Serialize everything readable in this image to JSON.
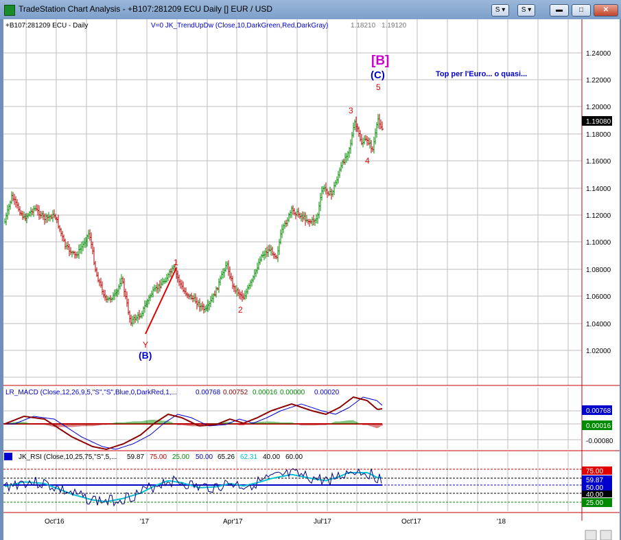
{
  "window": {
    "title": "TradeStation Chart Analysis - +B107:281209 ECU Daily [] EUR / USD",
    "buttons": {
      "a": "S ▾",
      "b": "S ▾",
      "min": "▬",
      "max": "□",
      "close": "✕"
    }
  },
  "main": {
    "symbol_label": "+B107:281209 ECU - Daily",
    "indicator_label": "V=0  JK_TrendUpDw (Close,10,DarkGreen,Red,DarkGray)",
    "indicator_v1": "1.18210",
    "indicator_v2": "1.19120",
    "price_ticks": [
      "1.24000",
      "1.22000",
      "1.20000",
      "1.18000",
      "1.16000",
      "1.14000",
      "1.12000",
      "1.10000",
      "1.08000",
      "1.06000",
      "1.04000",
      "1.02000"
    ],
    "last_price": "1.19080",
    "annotations": {
      "b_bracket": "[B]",
      "c_wave": "(C)",
      "b_wave": "(B)",
      "y": "Y",
      "w1": "1",
      "w2": "2",
      "w3": "3",
      "w4": "4",
      "w5": "5",
      "comment": "Top per l'Euro... o quasi..."
    }
  },
  "macd": {
    "label": "LR_MACD (Close,12,26,9,5,\"S\",\"S\",Blue,0,DarkRed,1,...",
    "v1": "0.00768",
    "v2": "0.00752",
    "v3": "0.00016",
    "v4": "0.00000",
    "v5": "0.00020",
    "ticks": [
      "0.00768",
      "0.00016",
      "-0.00080"
    ]
  },
  "rsi": {
    "label": "JK_RSI (Close,10,25,75,\"S\",5,...",
    "v1": "59.87",
    "v2": "75.00",
    "v3": "25.00",
    "v4": "50.00",
    "v5": "65.26",
    "v6": "62.31",
    "v7": "40.00",
    "v8": "60.00",
    "ticks": [
      "75.00",
      "59.87",
      "50.00",
      "40.00",
      "25.00"
    ]
  },
  "x_axis": [
    "Oct'16",
    "'17",
    "Apr'17",
    "Jul'17",
    "Oct'17",
    "'18"
  ],
  "colors": {
    "up": "#008a00",
    "down": "#b00000",
    "accent": "#0000cc",
    "wave": "#e00000",
    "bracket": "#cc00cc"
  }
}
